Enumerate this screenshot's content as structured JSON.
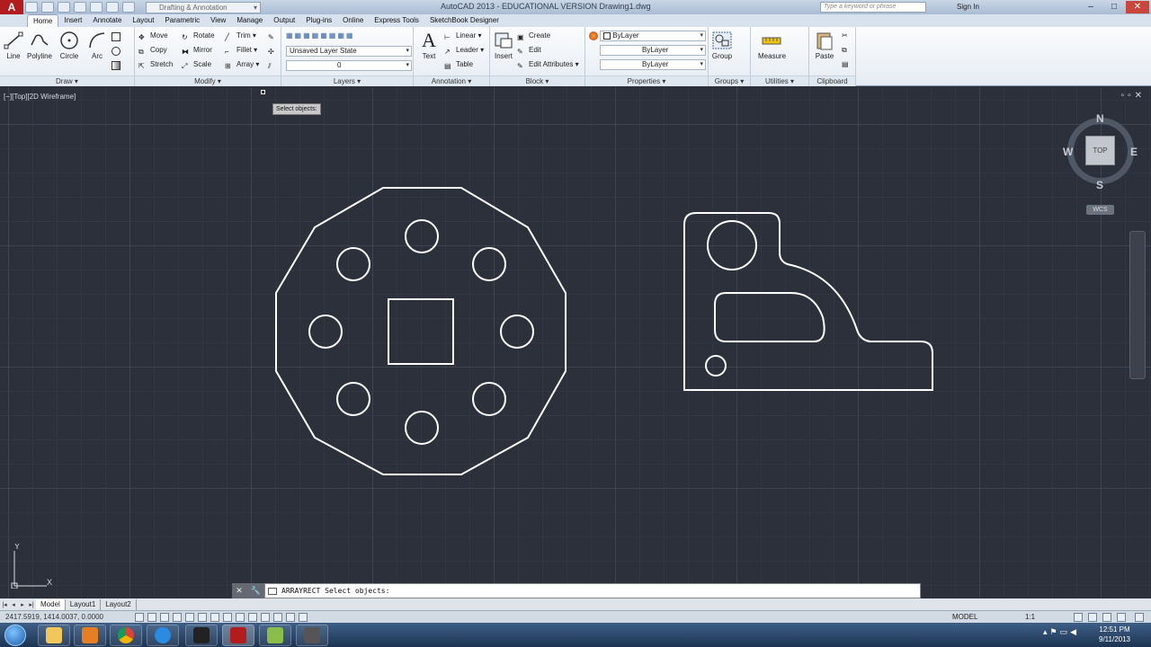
{
  "title_bar": {
    "app_logo": "A",
    "workspace": "Drafting & Annotation",
    "window_title": "AutoCAD 2013 - EDUCATIONAL VERSION    Drawing1.dwg",
    "search_placeholder": "Type a keyword or phrase",
    "sign_in": "Sign In"
  },
  "tabs": [
    "Home",
    "Insert",
    "Annotate",
    "Layout",
    "Parametric",
    "View",
    "Manage",
    "Output",
    "Plug-ins",
    "Online",
    "Express Tools",
    "SketchBook Designer"
  ],
  "ribbon": {
    "draw": {
      "title": "Draw",
      "line": "Line",
      "polyline": "Polyline",
      "circle": "Circle",
      "arc": "Arc"
    },
    "modify": {
      "title": "Modify",
      "move": "Move",
      "rotate": "Rotate",
      "trim": "Trim",
      "copy": "Copy",
      "mirror": "Mirror",
      "fillet": "Fillet",
      "stretch": "Stretch",
      "scale": "Scale",
      "array": "Array"
    },
    "layers": {
      "title": "Layers",
      "layer_state": "Unsaved Layer State",
      "current_layer": "0"
    },
    "annotation": {
      "title": "Annotation",
      "text": "Text",
      "linear": "Linear",
      "leader": "Leader",
      "table": "Table"
    },
    "block": {
      "title": "Block",
      "insert": "Insert",
      "create": "Create",
      "edit": "Edit",
      "edit_attributes": "Edit Attributes"
    },
    "properties": {
      "title": "Properties",
      "color": "ByLayer",
      "linetype": "ByLayer",
      "lineweight": "ByLayer"
    },
    "groups": {
      "title": "Groups",
      "group": "Group"
    },
    "utilities": {
      "title": "Utilities",
      "measure": "Measure"
    },
    "clipboard": {
      "title": "Clipboard",
      "paste": "Paste"
    }
  },
  "viewport": {
    "label": "[−][Top][2D Wireframe]",
    "tooltip": "Select objects:",
    "viewcube": {
      "top": "TOP",
      "n": "N",
      "s": "S",
      "e": "E",
      "w": "W",
      "wcs": "WCS"
    },
    "ucs": {
      "x": "X",
      "y": "Y"
    }
  },
  "command_line": {
    "text": "ARRAYRECT Select objects:"
  },
  "layout_tabs": [
    "Model",
    "Layout1",
    "Layout2"
  ],
  "status_bar": {
    "coords": "2417.5919, 1414.0037, 0.0000",
    "model": "MODEL",
    "scale": "1:1"
  },
  "taskbar": {
    "time": "12:51 PM",
    "date": "9/11/2013"
  },
  "colors": {
    "canvas": "#2b303b",
    "geometry": "#ffffff",
    "accent": "#b21c1c"
  }
}
